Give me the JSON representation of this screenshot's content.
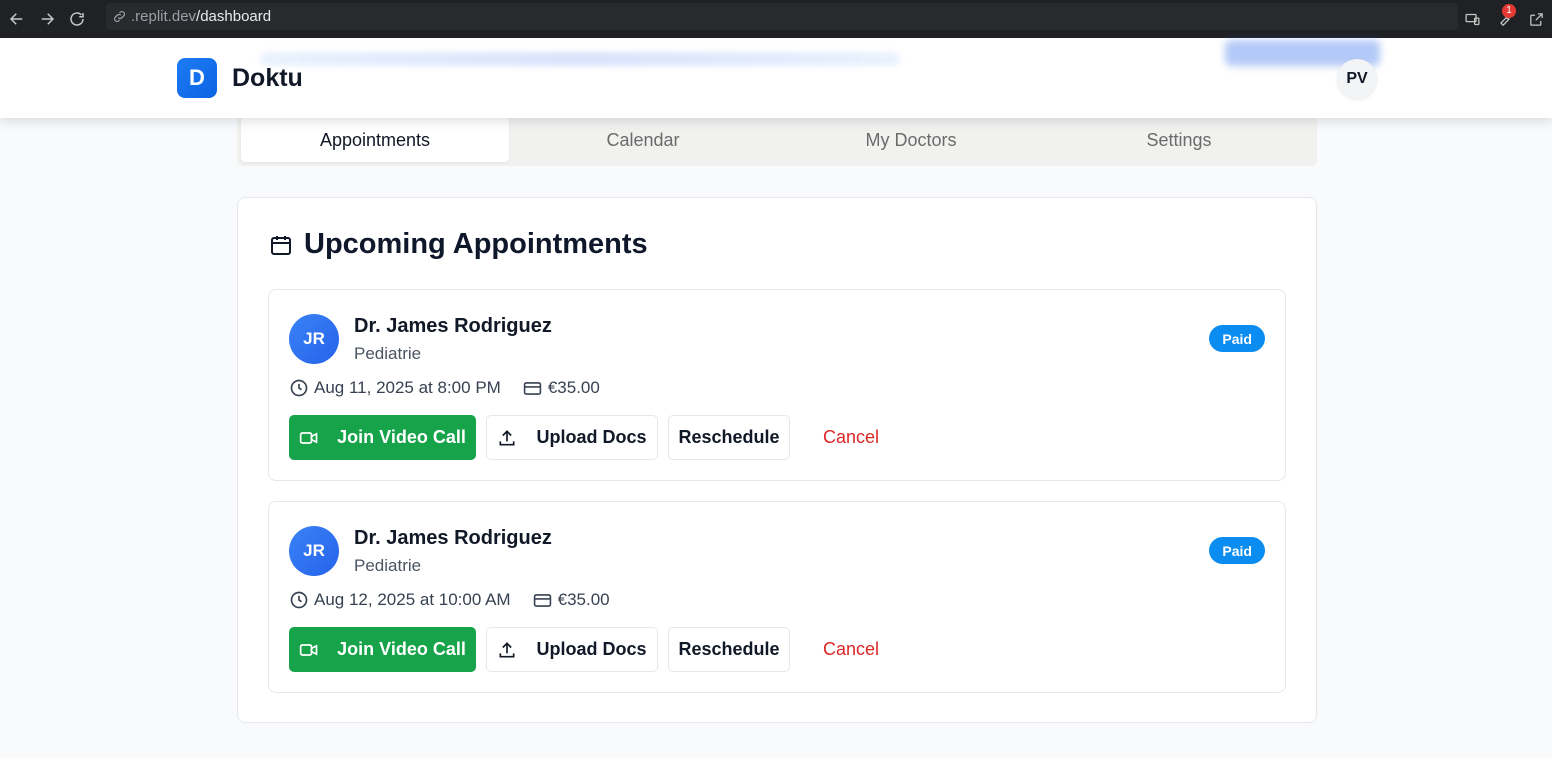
{
  "browser": {
    "url_host": ".replit.dev",
    "url_path": "/dashboard",
    "extension_badge": "1"
  },
  "header": {
    "logo_letter": "D",
    "brand": "Doktu",
    "user_initials": "PV"
  },
  "tabs": [
    {
      "label": "Appointments",
      "active": true
    },
    {
      "label": "Calendar",
      "active": false
    },
    {
      "label": "My Doctors",
      "active": false
    },
    {
      "label": "Settings",
      "active": false
    }
  ],
  "section": {
    "title": "Upcoming Appointments"
  },
  "appointments": [
    {
      "initials": "JR",
      "doctor": "Dr. James Rodriguez",
      "specialty": "Pediatrie",
      "status": "Paid",
      "datetime": "Aug 11, 2025 at 8:00 PM",
      "fee": "€35.00"
    },
    {
      "initials": "JR",
      "doctor": "Dr. James Rodriguez",
      "specialty": "Pediatrie",
      "status": "Paid",
      "datetime": "Aug 12, 2025 at 10:00 AM",
      "fee": "€35.00"
    }
  ],
  "actions": {
    "join": "Join Video Call",
    "upload": "Upload Docs",
    "reschedule": "Reschedule",
    "cancel": "Cancel"
  },
  "colors": {
    "primary": "#0b63e5",
    "join_green": "#16a34a",
    "paid_badge": "#0a8cf0",
    "cancel_red": "#dc2626"
  }
}
